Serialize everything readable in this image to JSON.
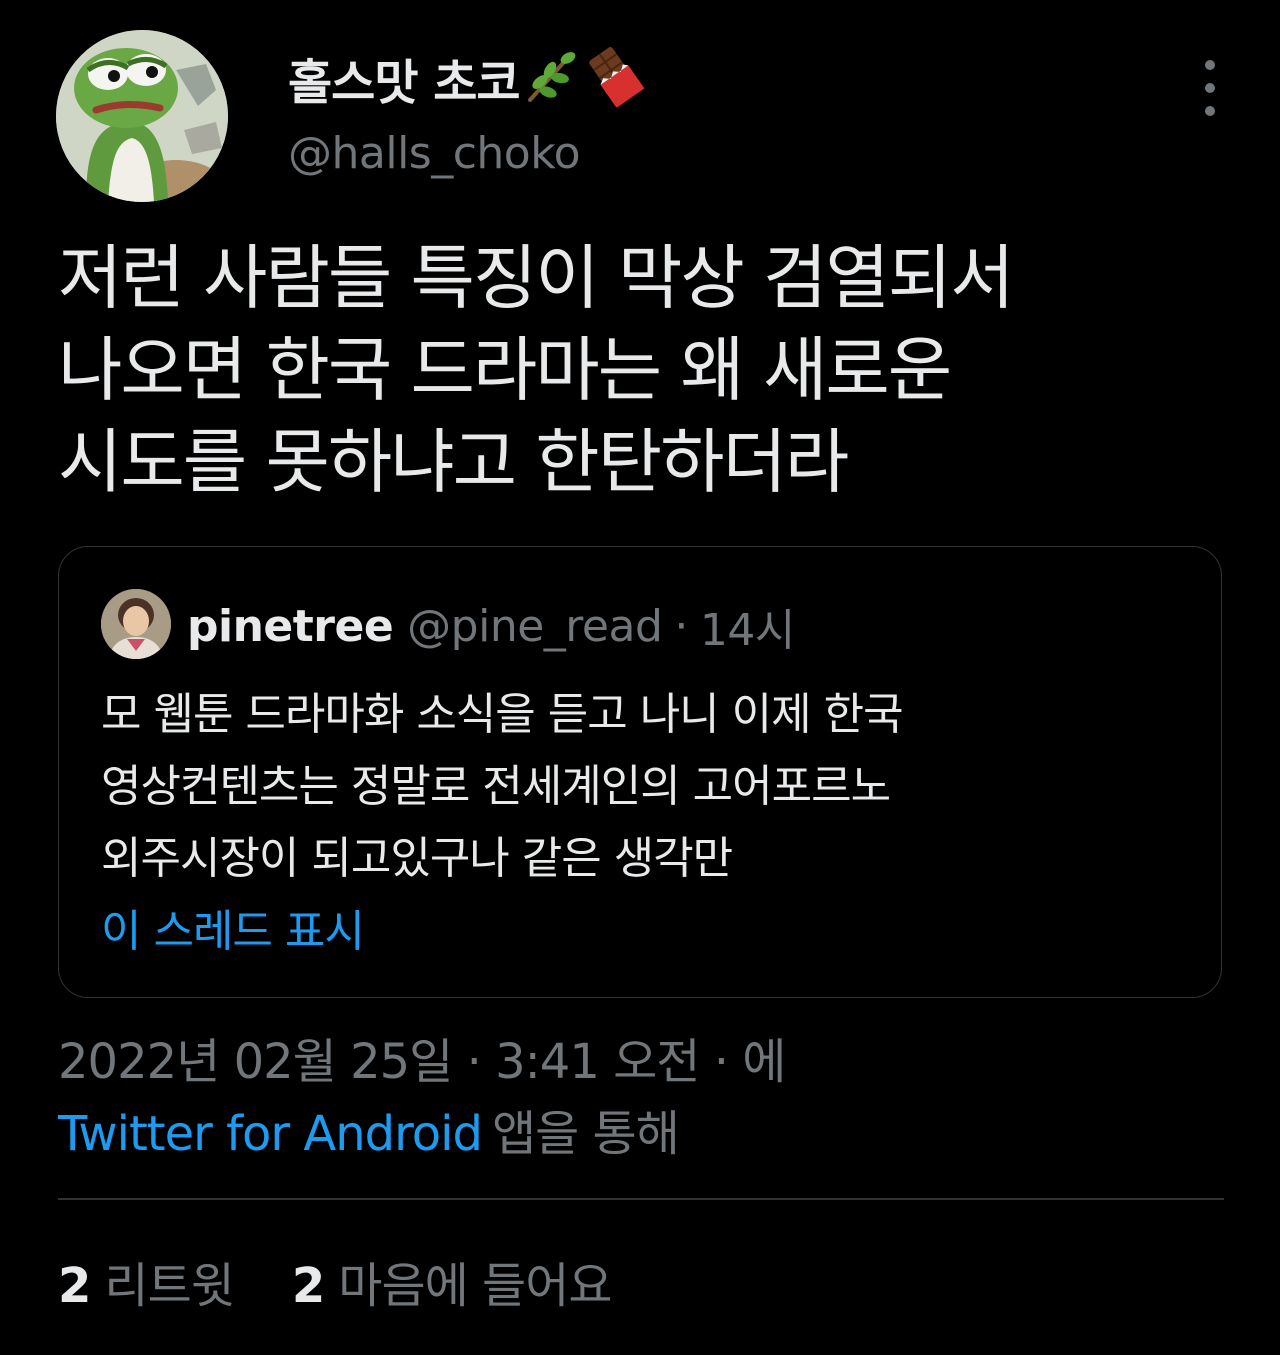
{
  "tweet": {
    "author": {
      "display_name": "홀스맛 초코",
      "name_emojis": [
        "herb-emoji",
        "chocolate-bar-emoji"
      ],
      "handle": "@halls_choko",
      "avatar_icon": "pepe-frog-avatar"
    },
    "more_icon": "more-vertical-icon",
    "text_lines": [
      "저런 사람들  특징이 막상 검열되서",
      "나오면 한국 드라마는 왜 새로운",
      "시도를 못하냐고 한탄하더라"
    ],
    "quote": {
      "author_name": "pinetree",
      "author_handle": "@pine_read",
      "separator": "·",
      "time": "14시",
      "avatar_icon": "person-photo-avatar",
      "text_lines": [
        "모 웹툰 드라마화 소식을 듣고 나니 이제 한국",
        "영상컨텐츠는 정말로 전세계인의 고어포르노",
        "외주시장이 되고있구나 같은 생각만"
      ],
      "show_thread_label": "이 스레드 표시"
    },
    "timestamp": "2022년 02월 25일 · 3:41 오전 · 에",
    "source_app": "Twitter for Android",
    "source_suffix": "앱을 통해",
    "stats": {
      "retweets_count": "2",
      "retweets_label": "리트윗",
      "likes_count": "2",
      "likes_label": "마음에 들어요"
    }
  },
  "colors": {
    "background": "#000000",
    "primary_text": "#e7e9ea",
    "secondary_text": "#71767b",
    "accent": "#1d9bf0",
    "border": "#2f3336"
  }
}
